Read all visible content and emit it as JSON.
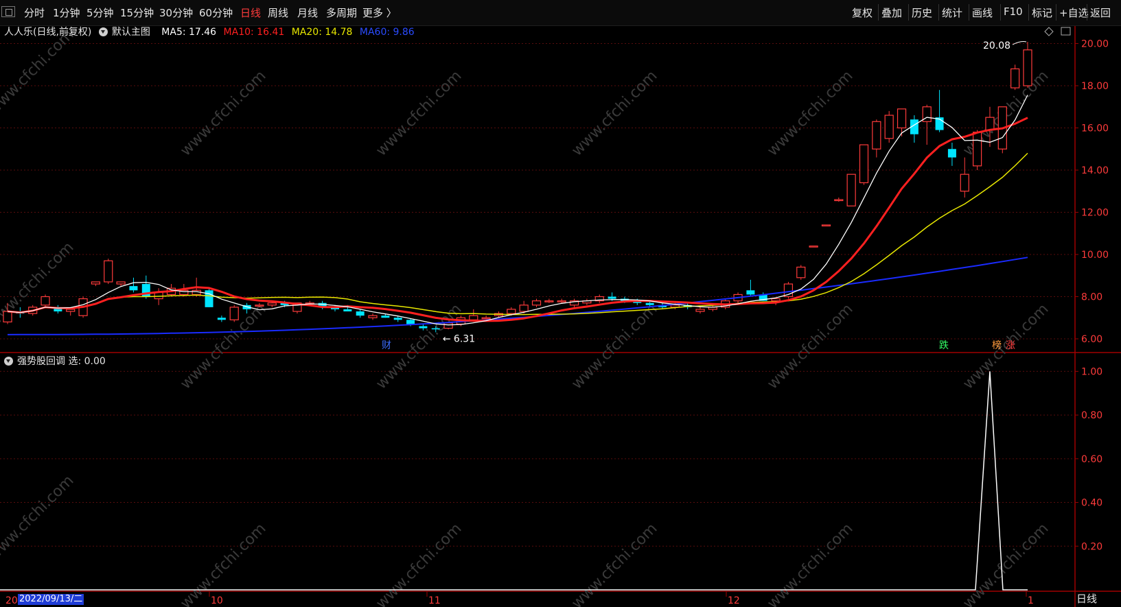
{
  "toolbar": {
    "left": [
      "分时",
      "1分钟",
      "5分钟",
      "15分钟",
      "30分钟",
      "60分钟",
      "日线",
      "周线",
      "月线",
      "多周期",
      "更多 〉"
    ],
    "active": "日线",
    "right": [
      "复权",
      "叠加",
      "历史",
      "统计",
      "画线",
      "F10",
      "标记",
      "+自选",
      "返回"
    ]
  },
  "legend": {
    "name": "人人乐(日线,前复权)",
    "main_label": "默认主图",
    "ma5": "MA5: 17.46",
    "ma10": "MA10: 16.41",
    "ma20": "MA20: 14.78",
    "ma60": "MA60: 9.86"
  },
  "indicator": {
    "name": "强势股回调",
    "value": "选: 0.00"
  },
  "annotations": {
    "high": "20.08",
    "low": "6.31",
    "cai": "财",
    "die": "跌",
    "bang": "榜",
    "zhang": "涨"
  },
  "axis": {
    "price_ticks": [
      "20.00",
      "18.00",
      "16.00",
      "14.00",
      "12.00",
      "10.00",
      "8.00",
      "6.00"
    ],
    "ind_ticks": [
      "1.00",
      "0.80",
      "0.60",
      "0.40",
      "0.20"
    ],
    "months": [
      "10",
      "11",
      "12",
      "1"
    ],
    "date": "2022/09/13/二",
    "period": "日线"
  },
  "watermark": "www.cfchi.com",
  "colors": {
    "up": "#ff3b3b",
    "down": "#00e5ff",
    "ma5": "#ffffff",
    "ma10": "#ff2020",
    "ma20": "#e8e800",
    "ma60": "#1a2bff",
    "axis": "#a00000"
  },
  "chart_data": {
    "type": "candlestick",
    "ohlc": [
      [
        6.8,
        7.7,
        6.7,
        7.3
      ],
      [
        7.3,
        7.5,
        7.0,
        7.2
      ],
      [
        7.2,
        7.6,
        7.1,
        7.5
      ],
      [
        7.6,
        8.1,
        7.5,
        8.0
      ],
      [
        7.5,
        7.6,
        7.2,
        7.3
      ],
      [
        7.3,
        7.5,
        7.1,
        7.4
      ],
      [
        7.1,
        8.0,
        7.0,
        7.9
      ],
      [
        8.6,
        8.7,
        8.5,
        8.7
      ],
      [
        8.7,
        9.8,
        8.6,
        9.7
      ],
      [
        8.6,
        8.7,
        8.5,
        8.7
      ],
      [
        8.5,
        8.9,
        8.2,
        8.3
      ],
      [
        8.6,
        9.0,
        7.9,
        8.0
      ],
      [
        7.9,
        8.4,
        7.6,
        8.2
      ],
      [
        8.1,
        8.6,
        8.0,
        8.4
      ],
      [
        8.1,
        8.6,
        8.0,
        8.3
      ],
      [
        8.1,
        8.9,
        8.0,
        8.3
      ],
      [
        8.3,
        8.4,
        7.5,
        7.5
      ],
      [
        7.0,
        7.1,
        6.8,
        6.9
      ],
      [
        6.9,
        7.6,
        6.8,
        7.5
      ],
      [
        7.6,
        7.7,
        7.2,
        7.4
      ],
      [
        7.6,
        7.7,
        7.5,
        7.6
      ],
      [
        7.6,
        7.8,
        7.5,
        7.7
      ],
      [
        7.7,
        7.8,
        7.5,
        7.6
      ],
      [
        7.3,
        7.7,
        7.2,
        7.7
      ],
      [
        7.7,
        7.8,
        7.6,
        7.7
      ],
      [
        7.7,
        7.8,
        7.4,
        7.5
      ],
      [
        7.5,
        7.6,
        7.3,
        7.4
      ],
      [
        7.4,
        7.6,
        7.3,
        7.3
      ],
      [
        7.3,
        7.4,
        7.0,
        7.1
      ],
      [
        7.0,
        7.2,
        6.9,
        7.1
      ],
      [
        7.1,
        7.2,
        7.0,
        7.0
      ],
      [
        7.0,
        7.1,
        6.8,
        6.9
      ],
      [
        6.9,
        6.95,
        6.6,
        6.7
      ],
      [
        6.6,
        6.7,
        6.4,
        6.5
      ],
      [
        6.5,
        6.6,
        6.31,
        6.45
      ],
      [
        6.5,
        6.8,
        6.45,
        6.75
      ],
      [
        6.7,
        7.1,
        6.6,
        7.0
      ],
      [
        6.9,
        7.4,
        6.8,
        7.1
      ],
      [
        7.0,
        7.1,
        6.9,
        7.0
      ],
      [
        7.1,
        7.3,
        7.0,
        7.2
      ],
      [
        7.2,
        7.5,
        7.1,
        7.4
      ],
      [
        7.3,
        7.8,
        7.2,
        7.6
      ],
      [
        7.6,
        7.9,
        7.5,
        7.8
      ],
      [
        7.8,
        7.9,
        7.7,
        7.8
      ],
      [
        7.8,
        7.9,
        7.7,
        7.8
      ],
      [
        7.6,
        7.9,
        7.5,
        7.8
      ],
      [
        7.7,
        7.9,
        7.6,
        7.8
      ],
      [
        7.8,
        8.1,
        7.7,
        8.0
      ],
      [
        8.0,
        8.2,
        7.8,
        7.9
      ],
      [
        7.9,
        8.0,
        7.7,
        7.8
      ],
      [
        7.8,
        7.9,
        7.6,
        7.7
      ],
      [
        7.7,
        7.8,
        7.5,
        7.6
      ],
      [
        7.6,
        7.8,
        7.4,
        7.5
      ],
      [
        7.5,
        7.7,
        7.4,
        7.6
      ],
      [
        7.6,
        7.7,
        7.4,
        7.5
      ],
      [
        7.3,
        7.5,
        7.2,
        7.4
      ],
      [
        7.4,
        7.6,
        7.3,
        7.5
      ],
      [
        7.5,
        7.9,
        7.4,
        7.8
      ],
      [
        7.8,
        8.2,
        7.7,
        8.1
      ],
      [
        8.3,
        8.8,
        8.0,
        8.1
      ],
      [
        8.1,
        8.2,
        7.8,
        7.8
      ],
      [
        7.8,
        7.9,
        7.6,
        7.9
      ],
      [
        8.0,
        8.7,
        7.9,
        8.6
      ],
      [
        8.9,
        9.5,
        8.8,
        9.4
      ],
      [
        10.4,
        10.4,
        10.4,
        10.4
      ],
      [
        11.4,
        11.4,
        11.4,
        11.4
      ],
      [
        12.6,
        12.7,
        12.5,
        12.6
      ],
      [
        12.3,
        13.8,
        12.3,
        13.8
      ],
      [
        13.4,
        15.2,
        13.3,
        15.2
      ],
      [
        15.0,
        16.4,
        14.6,
        16.3
      ],
      [
        15.5,
        16.8,
        15.3,
        16.6
      ],
      [
        16.0,
        16.9,
        15.6,
        16.9
      ],
      [
        16.4,
        16.6,
        15.3,
        15.7
      ],
      [
        16.3,
        17.1,
        15.2,
        17.0
      ],
      [
        16.5,
        17.8,
        15.8,
        15.9
      ],
      [
        15.0,
        15.3,
        14.2,
        14.6
      ],
      [
        13.0,
        14.6,
        12.7,
        13.8
      ],
      [
        14.2,
        15.9,
        14.0,
        15.8
      ],
      [
        15.9,
        17.0,
        15.1,
        16.5
      ],
      [
        15.0,
        17.0,
        14.8,
        17.0
      ],
      [
        17.9,
        19.0,
        17.8,
        18.8
      ],
      [
        18.0,
        20.08,
        17.9,
        19.7
      ]
    ],
    "ma60_range": [
      6.2,
      9.86
    ],
    "indicator_spike": 1.0,
    "ylim": [
      5.6,
      20.5
    ],
    "ind_ylim": [
      0,
      1.05
    ]
  }
}
